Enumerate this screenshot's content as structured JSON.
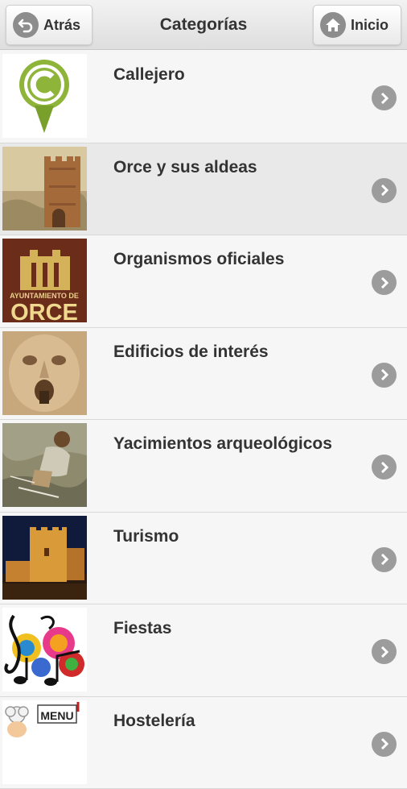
{
  "header": {
    "back_label": "Atrás",
    "title": "Categorías",
    "home_label": "Inicio"
  },
  "categories": [
    {
      "label": "Callejero",
      "icon": "callejero-logo-icon"
    },
    {
      "label": "Orce y sus aldeas",
      "icon": "castle-tower-photo"
    },
    {
      "label": "Organismos oficiales",
      "icon": "ayuntamiento-orce-logo",
      "logo_text_top": "AYUNTAMIENTO DE",
      "logo_text_main": "ORCE"
    },
    {
      "label": "Edificios de interés",
      "icon": "stone-face-fountain-photo"
    },
    {
      "label": "Yacimientos arqueológicos",
      "icon": "archaeologist-digging-photo"
    },
    {
      "label": "Turismo",
      "icon": "castle-at-night-photo"
    },
    {
      "label": "Fiestas",
      "icon": "music-notes-icon"
    },
    {
      "label": "Hostelería",
      "icon": "chef-menu-icon",
      "logo_text": "MENU"
    }
  ],
  "colors": {
    "accent_green": "#7aa02c",
    "arrow_gray": "#9c9c9c",
    "selected_row": "#e9e9e9"
  }
}
